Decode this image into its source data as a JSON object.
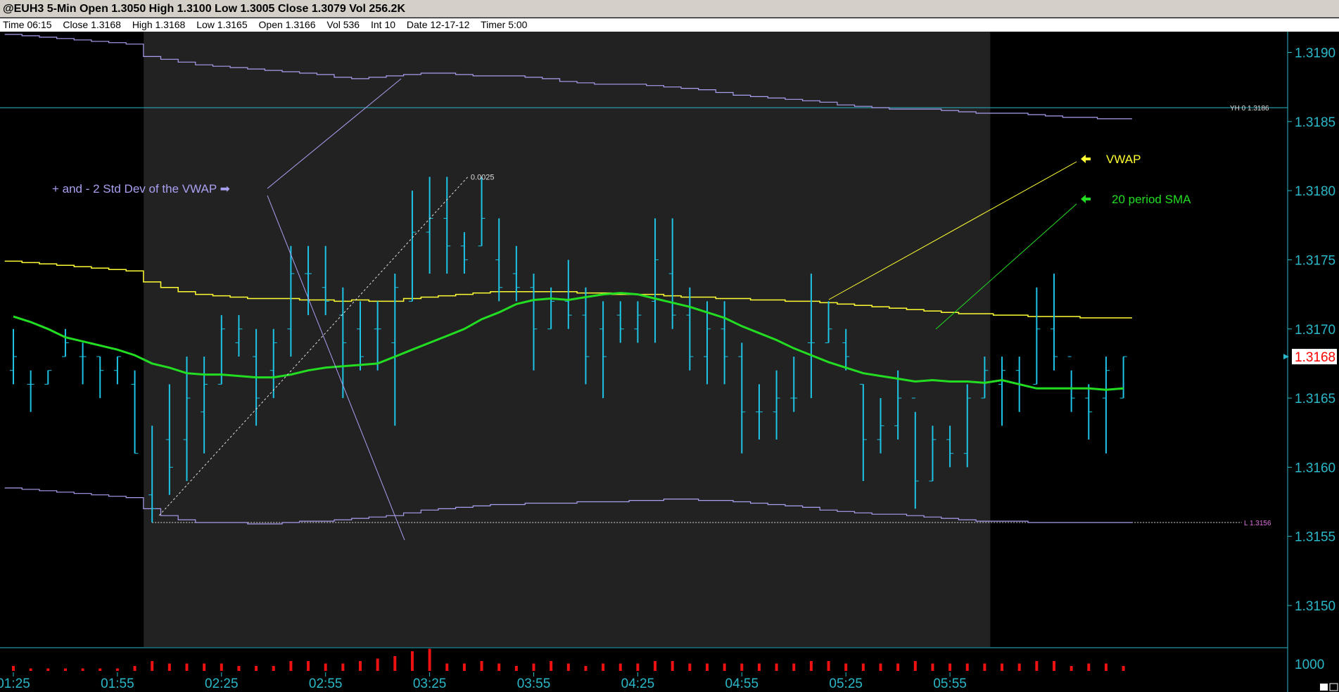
{
  "window": {
    "title": "@EUH3 5-Min Open 1.3050 High 1.3100 Low 1.3005 Close 1.3079 Vol 256.2K"
  },
  "info_bar": {
    "time": "Time 06:15",
    "close": "Close 1.3168",
    "high": "High 1.3168",
    "low": "Low 1.3165",
    "open": "Open 1.3166",
    "vol": "Vol 536",
    "int": "Int 10",
    "date": "Date 12-17-12",
    "timer": "Timer 5:00"
  },
  "colors": {
    "bars": "#1ec4e6",
    "vwap": "#ffff33",
    "sma": "#22dd22",
    "bands": "#a8a0f0",
    "axis": "#2ab7c8",
    "volume": "#ee1111",
    "session_shade": "#222222",
    "last_price_bg": "#ffffff",
    "last_price_text": "#ff0000"
  },
  "chart_data": {
    "type": "ohlc",
    "y_axis": {
      "ticks": [
        "1.3190",
        "1.3185",
        "1.3180",
        "1.3175",
        "1.3170",
        "1.3165",
        "1.3160",
        "1.3155",
        "1.3150"
      ],
      "ylim": [
        1.3147,
        1.31915
      ],
      "last_price_label": "1.3168",
      "volume_tick": "1000"
    },
    "x_axis": {
      "ticks": [
        "01:25",
        "01:55",
        "02:25",
        "02:55",
        "03:25",
        "03:55",
        "04:25",
        "04:55",
        "05:25",
        "05:55"
      ],
      "bar_minutes": 5
    },
    "bars": [
      {
        "o": 1.3167,
        "h": 1.317,
        "l": 1.3166,
        "c": 1.3168
      },
      {
        "o": 1.3166,
        "h": 1.3167,
        "l": 1.3164,
        "c": 1.3166
      },
      {
        "o": 1.3166,
        "h": 1.3167,
        "l": 1.3166,
        "c": 1.3167
      },
      {
        "o": 1.3168,
        "h": 1.317,
        "l": 1.3168,
        "c": 1.3169
      },
      {
        "o": 1.3168,
        "h": 1.3169,
        "l": 1.3166,
        "c": 1.3168
      },
      {
        "o": 1.3168,
        "h": 1.3168,
        "l": 1.3165,
        "c": 1.3167
      },
      {
        "o": 1.3167,
        "h": 1.3168,
        "l": 1.3166,
        "c": 1.3168
      },
      {
        "o": 1.3166,
        "h": 1.3167,
        "l": 1.3161,
        "c": 1.3161
      },
      {
        "o": 1.3158,
        "h": 1.3163,
        "l": 1.3156,
        "c": 1.3157
      },
      {
        "o": 1.3162,
        "h": 1.3166,
        "l": 1.3158,
        "c": 1.316
      },
      {
        "o": 1.3162,
        "h": 1.3168,
        "l": 1.3159,
        "c": 1.3165
      },
      {
        "o": 1.3164,
        "h": 1.3168,
        "l": 1.3161,
        "c": 1.3166
      },
      {
        "o": 1.3166,
        "h": 1.3171,
        "l": 1.3166,
        "c": 1.317
      },
      {
        "o": 1.3169,
        "h": 1.3171,
        "l": 1.3168,
        "c": 1.317
      },
      {
        "o": 1.3168,
        "h": 1.317,
        "l": 1.3163,
        "c": 1.3165
      },
      {
        "o": 1.3167,
        "h": 1.317,
        "l": 1.3165,
        "c": 1.3169
      },
      {
        "o": 1.317,
        "h": 1.3176,
        "l": 1.3168,
        "c": 1.3174
      },
      {
        "o": 1.3174,
        "h": 1.3176,
        "l": 1.3171,
        "c": 1.3174
      },
      {
        "o": 1.3173,
        "h": 1.3176,
        "l": 1.3171,
        "c": 1.3172
      },
      {
        "o": 1.3171,
        "h": 1.3173,
        "l": 1.3165,
        "c": 1.3169
      },
      {
        "o": 1.317,
        "h": 1.3172,
        "l": 1.3167,
        "c": 1.3168
      },
      {
        "o": 1.317,
        "h": 1.3172,
        "l": 1.3167,
        "c": 1.317
      },
      {
        "o": 1.3169,
        "h": 1.3174,
        "l": 1.3163,
        "c": 1.3173
      },
      {
        "o": 1.3172,
        "h": 1.318,
        "l": 1.3172,
        "c": 1.3177
      },
      {
        "o": 1.3177,
        "h": 1.3181,
        "l": 1.3174,
        "c": 1.3178
      },
      {
        "o": 1.3178,
        "h": 1.3181,
        "l": 1.3174,
        "c": 1.3176
      },
      {
        "o": 1.3176,
        "h": 1.3177,
        "l": 1.3174,
        "c": 1.3175
      },
      {
        "o": 1.3176,
        "h": 1.3181,
        "l": 1.3176,
        "c": 1.3178
      },
      {
        "o": 1.3175,
        "h": 1.3178,
        "l": 1.3172,
        "c": 1.3173
      },
      {
        "o": 1.3174,
        "h": 1.3176,
        "l": 1.3172,
        "c": 1.3173
      },
      {
        "o": 1.3173,
        "h": 1.3174,
        "l": 1.3167,
        "c": 1.317
      },
      {
        "o": 1.317,
        "h": 1.3173,
        "l": 1.317,
        "c": 1.3172
      },
      {
        "o": 1.3172,
        "h": 1.3175,
        "l": 1.317,
        "c": 1.3171
      },
      {
        "o": 1.3171,
        "h": 1.3173,
        "l": 1.3166,
        "c": 1.3168
      },
      {
        "o": 1.317,
        "h": 1.3172,
        "l": 1.3165,
        "c": 1.3168
      },
      {
        "o": 1.3171,
        "h": 1.3172,
        "l": 1.3169,
        "c": 1.317
      },
      {
        "o": 1.317,
        "h": 1.3172,
        "l": 1.3169,
        "c": 1.3171
      },
      {
        "o": 1.3172,
        "h": 1.3178,
        "l": 1.3169,
        "c": 1.3175
      },
      {
        "o": 1.3174,
        "h": 1.3178,
        "l": 1.317,
        "c": 1.3171
      },
      {
        "o": 1.3171,
        "h": 1.3173,
        "l": 1.3167,
        "c": 1.3168
      },
      {
        "o": 1.3168,
        "h": 1.3172,
        "l": 1.3166,
        "c": 1.317
      },
      {
        "o": 1.317,
        "h": 1.3172,
        "l": 1.3166,
        "c": 1.3168
      },
      {
        "o": 1.3168,
        "h": 1.3169,
        "l": 1.3161,
        "c": 1.3164
      },
      {
        "o": 1.3164,
        "h": 1.3166,
        "l": 1.3162,
        "c": 1.3164
      },
      {
        "o": 1.3164,
        "h": 1.3167,
        "l": 1.3162,
        "c": 1.3165
      },
      {
        "o": 1.3165,
        "h": 1.3168,
        "l": 1.3164,
        "c": 1.3165
      },
      {
        "o": 1.3169,
        "h": 1.3174,
        "l": 1.3165,
        "c": 1.3169
      },
      {
        "o": 1.3169,
        "h": 1.3172,
        "l": 1.3169,
        "c": 1.317
      },
      {
        "o": 1.3169,
        "h": 1.317,
        "l": 1.3167,
        "c": 1.3168
      },
      {
        "o": 1.3166,
        "h": 1.3166,
        "l": 1.3159,
        "c": 1.3162
      },
      {
        "o": 1.3162,
        "h": 1.3165,
        "l": 1.3161,
        "c": 1.3163
      },
      {
        "o": 1.3163,
        "h": 1.3167,
        "l": 1.3162,
        "c": 1.3165
      },
      {
        "o": 1.3165,
        "h": 1.3164,
        "l": 1.3157,
        "c": 1.3159
      },
      {
        "o": 1.3159,
        "h": 1.3163,
        "l": 1.3159,
        "c": 1.3162
      },
      {
        "o": 1.3162,
        "h": 1.3163,
        "l": 1.316,
        "c": 1.3161
      },
      {
        "o": 1.3161,
        "h": 1.3166,
        "l": 1.316,
        "c": 1.3165
      },
      {
        "o": 1.3165,
        "h": 1.3168,
        "l": 1.3165,
        "c": 1.3167
      },
      {
        "o": 1.3166,
        "h": 1.3168,
        "l": 1.3163,
        "c": 1.3167
      },
      {
        "o": 1.3167,
        "h": 1.3168,
        "l": 1.3164,
        "c": 1.3166
      },
      {
        "o": 1.3166,
        "h": 1.3173,
        "l": 1.3166,
        "c": 1.317
      },
      {
        "o": 1.317,
        "h": 1.3174,
        "l": 1.3167,
        "c": 1.3168
      },
      {
        "o": 1.3168,
        "h": 1.3167,
        "l": 1.3164,
        "c": 1.3165
      },
      {
        "o": 1.3165,
        "h": 1.3166,
        "l": 1.3162,
        "c": 1.3164
      },
      {
        "o": 1.3165,
        "h": 1.3168,
        "l": 1.3161,
        "c": 1.3167
      },
      {
        "o": 1.3165,
        "h": 1.3168,
        "l": 1.3165,
        "c": 1.3168
      }
    ],
    "volume": [
      2,
      1,
      1,
      1,
      1,
      1,
      1,
      2,
      4,
      3,
      3,
      3,
      3,
      2,
      2,
      2,
      4,
      4,
      3,
      3,
      4,
      5,
      6,
      8,
      9,
      3,
      3,
      4,
      3,
      2,
      3,
      4,
      3,
      2,
      3,
      3,
      3,
      4,
      4,
      3,
      3,
      3,
      3,
      3,
      3,
      3,
      4,
      4,
      3,
      3,
      3,
      3,
      4,
      3,
      3,
      3,
      3,
      3,
      3,
      4,
      4,
      2,
      3,
      3,
      2
    ],
    "vwap": [
      1.31749,
      1.31748,
      1.31747,
      1.31746,
      1.31745,
      1.31744,
      1.31743,
      1.31742,
      1.31734,
      1.3173,
      1.31727,
      1.31725,
      1.31724,
      1.31723,
      1.31722,
      1.31722,
      1.31722,
      1.31721,
      1.31721,
      1.3172,
      1.31721,
      1.3172,
      1.3172,
      1.31722,
      1.31723,
      1.31724,
      1.31725,
      1.31726,
      1.31727,
      1.31727,
      1.31727,
      1.31727,
      1.31727,
      1.31726,
      1.31726,
      1.31725,
      1.31725,
      1.31725,
      1.31724,
      1.31723,
      1.31723,
      1.31722,
      1.31722,
      1.31721,
      1.31721,
      1.3172,
      1.3172,
      1.31719,
      1.31718,
      1.31717,
      1.31716,
      1.31715,
      1.31714,
      1.31713,
      1.31712,
      1.31711,
      1.31711,
      1.3171,
      1.3171,
      1.31709,
      1.31709,
      1.31709,
      1.31708,
      1.31708,
      1.31708
    ],
    "sma20": [
      1.31709,
      1.31705,
      1.317,
      1.31694,
      1.31691,
      1.31688,
      1.31685,
      1.31681,
      1.31675,
      1.31672,
      1.31668,
      1.31667,
      1.31667,
      1.31666,
      1.31665,
      1.31665,
      1.31667,
      1.3167,
      1.31672,
      1.31673,
      1.31674,
      1.31675,
      1.3168,
      1.31685,
      1.3169,
      1.31695,
      1.317,
      1.31707,
      1.31712,
      1.31718,
      1.31721,
      1.31722,
      1.31721,
      1.31723,
      1.31725,
      1.31726,
      1.31725,
      1.31722,
      1.31719,
      1.31716,
      1.31712,
      1.31708,
      1.31702,
      1.31697,
      1.31692,
      1.31686,
      1.31681,
      1.31676,
      1.31672,
      1.31668,
      1.31666,
      1.31664,
      1.31662,
      1.31663,
      1.31662,
      1.31662,
      1.31661,
      1.31663,
      1.3166,
      1.31657,
      1.31657,
      1.31657,
      1.31657,
      1.31656,
      1.31657
    ],
    "band_upper": [
      1.31913,
      1.31912,
      1.31911,
      1.3191,
      1.31909,
      1.31908,
      1.31907,
      1.31906,
      1.31897,
      1.31895,
      1.31893,
      1.31891,
      1.3189,
      1.31889,
      1.31888,
      1.31887,
      1.31886,
      1.31885,
      1.31884,
      1.31882,
      1.31881,
      1.31882,
      1.31883,
      1.31884,
      1.31885,
      1.31885,
      1.31884,
      1.31883,
      1.31883,
      1.31883,
      1.31882,
      1.31881,
      1.31879,
      1.31878,
      1.31877,
      1.31877,
      1.31877,
      1.31876,
      1.31875,
      1.31874,
      1.31873,
      1.31871,
      1.31869,
      1.31868,
      1.31867,
      1.31866,
      1.31865,
      1.31864,
      1.31862,
      1.31861,
      1.3186,
      1.31859,
      1.31859,
      1.31859,
      1.31858,
      1.31857,
      1.31856,
      1.31856,
      1.31856,
      1.31855,
      1.31854,
      1.31853,
      1.31853,
      1.31852,
      1.31852
    ],
    "band_lower": [
      1.31585,
      1.31584,
      1.31583,
      1.31582,
      1.31581,
      1.3158,
      1.31579,
      1.31578,
      1.3157,
      1.31565,
      1.31562,
      1.3156,
      1.3156,
      1.3156,
      1.31559,
      1.31559,
      1.3156,
      1.31561,
      1.31561,
      1.31562,
      1.31563,
      1.31564,
      1.31565,
      1.31567,
      1.31569,
      1.3157,
      1.31571,
      1.31572,
      1.31573,
      1.31573,
      1.31574,
      1.31574,
      1.31574,
      1.31575,
      1.31575,
      1.31575,
      1.31576,
      1.31576,
      1.31577,
      1.31577,
      1.31576,
      1.31576,
      1.31575,
      1.31574,
      1.31573,
      1.31572,
      1.31571,
      1.31569,
      1.31568,
      1.31567,
      1.31566,
      1.31566,
      1.31565,
      1.31564,
      1.31563,
      1.31562,
      1.31561,
      1.31561,
      1.31561,
      1.3156,
      1.3156,
      1.3156,
      1.3156,
      1.3156,
      1.3156
    ],
    "session_start_index": 8,
    "session_end_index": 56,
    "reference_lines": [
      {
        "label": "YH 0 1.3186",
        "value": 1.3186
      },
      {
        "label": "L 1.3156",
        "value": 1.3156
      }
    ],
    "measure": {
      "label": "0.0025",
      "from_index": 8,
      "from_value": 1.3156,
      "to_index": 26,
      "to_value": 1.3181
    },
    "annotations": [
      {
        "text": "+ and - 2 Std Dev of the VWAP ➡"
      },
      {
        "text": "VWAP"
      },
      {
        "text": "20 period SMA"
      }
    ]
  }
}
